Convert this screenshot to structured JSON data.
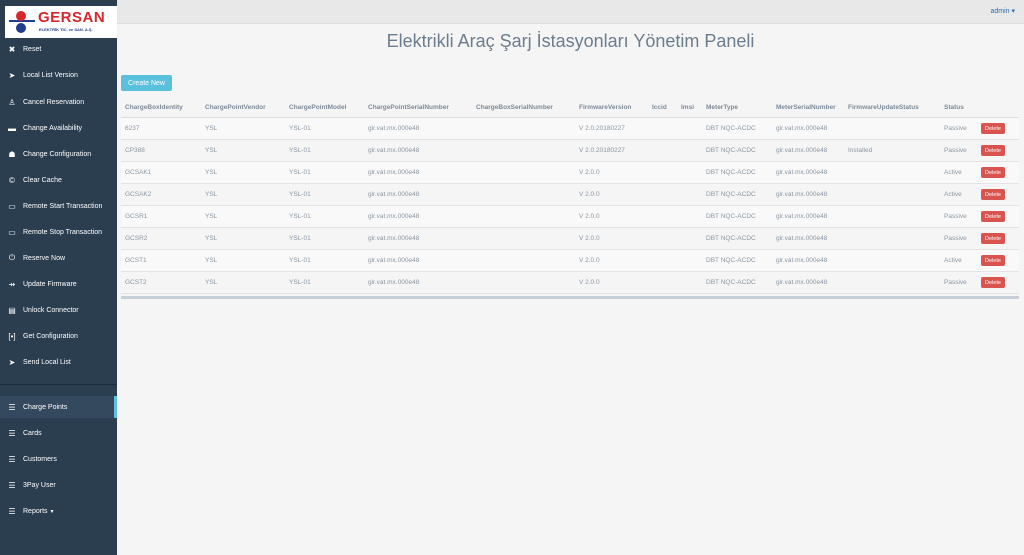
{
  "brand": {
    "name": "GERSAN",
    "subtitle": "ELEKTRİK TİC. ve SAN. A.Ş."
  },
  "sidebar": {
    "items": [
      {
        "label": "Reset",
        "icon": "close-icon"
      },
      {
        "label": "Local List Version",
        "icon": "send-icon"
      },
      {
        "label": "Cancel Reservation",
        "icon": "person-icon"
      },
      {
        "label": "Change Availability",
        "icon": "window-icon"
      },
      {
        "label": "Change Configuration",
        "icon": "android-icon"
      },
      {
        "label": "Clear Cache",
        "icon": "copyright-icon"
      },
      {
        "label": "Remote Start Transaction",
        "icon": "monitor-icon"
      },
      {
        "label": "Remote Stop Transaction",
        "icon": "monitor-icon"
      },
      {
        "label": "Reserve Now",
        "icon": "power-icon"
      },
      {
        "label": "Update Firmware",
        "icon": "usb-icon"
      },
      {
        "label": "Unlock Connector",
        "icon": "card-icon"
      },
      {
        "label": "Get Configuration",
        "icon": "brackets-icon"
      },
      {
        "label": "Send Local List",
        "icon": "send-icon"
      }
    ],
    "bottom_items": [
      {
        "label": "Charge Points",
        "icon": "list-icon"
      },
      {
        "label": "Cards",
        "icon": "list-icon"
      },
      {
        "label": "Customers",
        "icon": "list-icon"
      },
      {
        "label": "3Pay User",
        "icon": "list-icon"
      },
      {
        "label": "Reports",
        "icon": "list-icon",
        "caret": "▾"
      }
    ]
  },
  "topbar": {
    "user": "admin ▾"
  },
  "page": {
    "title": "Elektrikli Araç Şarj İstasyonları Yönetim Paneli",
    "create_label": "Create New"
  },
  "table": {
    "headers": [
      "ChargeBoxIdentity",
      "ChargePointVendor",
      "ChargePointModel",
      "ChargePointSerialNumber",
      "ChargeBoxSerialNumber",
      "FirmwareVersion",
      "Iccid",
      "Imsi",
      "MeterType",
      "MeterSerialNumber",
      "FirmwareUpdateStatus",
      "Status"
    ],
    "delete_label": "Delete",
    "rows": [
      [
        "6237",
        "YSL",
        "YSL-01",
        "gir.vat.mx.000e48",
        "",
        "V 2.0.20180227",
        "",
        "",
        "DBT NQC-ACDC",
        "gir.vat.mx.000e48",
        "",
        "Passive"
      ],
      [
        "CP388",
        "YSL",
        "YSL-01",
        "gir.vat.mx.000e48",
        "",
        "V 2.0.20180227",
        "",
        "",
        "DBT NQC-ACDC",
        "gir.vat.mx.000e48",
        "Installed",
        "Passive"
      ],
      [
        "GCSAK1",
        "YSL",
        "YSL-01",
        "gir.vat.mx.000e48",
        "",
        "V 2.0.0",
        "",
        "",
        "DBT NQC-ACDC",
        "gir.vat.mx.000e48",
        "",
        "Active"
      ],
      [
        "GCSAK2",
        "YSL",
        "YSL-01",
        "gir.vat.mx.000e48",
        "",
        "V 2.0.0",
        "",
        "",
        "DBT NQC-ACDC",
        "gir.vat.mx.000e48",
        "",
        "Active"
      ],
      [
        "GCSR1",
        "YSL",
        "YSL-01",
        "gir.vat.mx.000e48",
        "",
        "V 2.0.0",
        "",
        "",
        "DBT NQC-ACDC",
        "gir.vat.mx.000e48",
        "",
        "Passive"
      ],
      [
        "GCSR2",
        "YSL",
        "YSL-01",
        "gir.vat.mx.000e48",
        "",
        "V 2.0.0",
        "",
        "",
        "DBT NQC-ACDC",
        "gir.vat.mx.000e48",
        "",
        "Passive"
      ],
      [
        "GCST1",
        "YSL",
        "YSL-01",
        "gir.vat.mx.000e48",
        "",
        "V 2.0.0",
        "",
        "",
        "DBT NQC-ACDC",
        "gir.vat.mx.000e48",
        "",
        "Active"
      ],
      [
        "GCST2",
        "YSL",
        "YSL-01",
        "gir.vat.mx.000e48",
        "",
        "V 2.0.0",
        "",
        "",
        "DBT NQC-ACDC",
        "gir.vat.mx.000e48",
        "",
        "Passive"
      ]
    ]
  },
  "colors": {
    "sidebar_bg": "#2b3e50",
    "accent": "#5bc0de",
    "danger": "#d9534f",
    "brand_red": "#d9262c",
    "brand_blue": "#1f3d8a"
  }
}
